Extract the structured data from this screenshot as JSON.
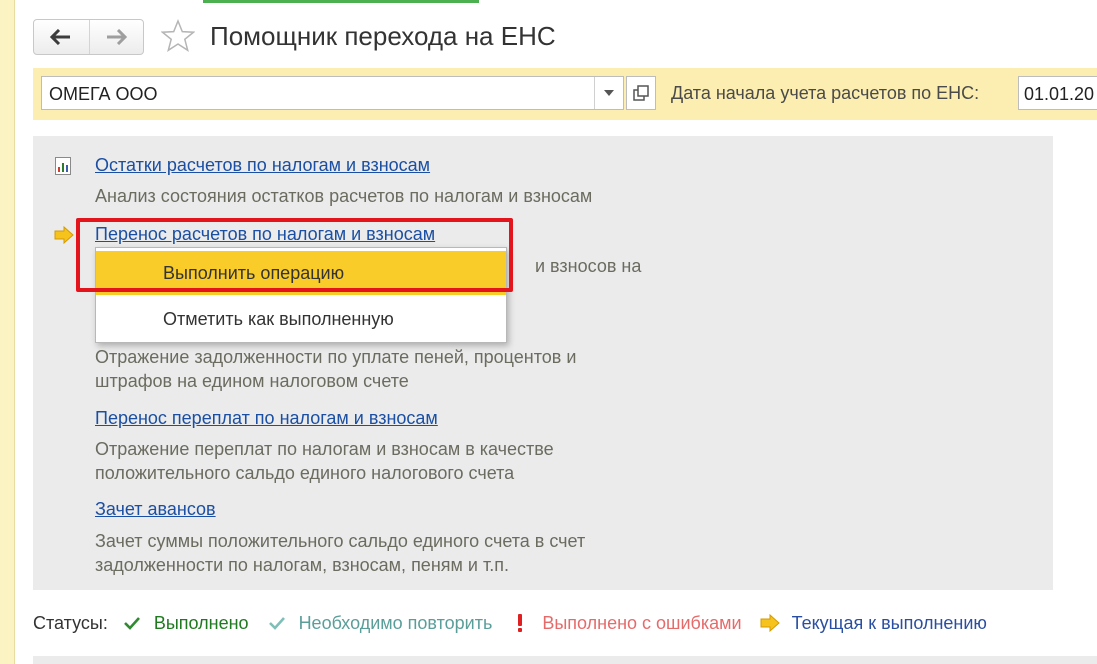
{
  "window": {
    "title": "Помощник перехода на ЕНС"
  },
  "navigation": {
    "back_icon": "arrow-left-icon",
    "forward_icon": "arrow-right-icon",
    "favorite_icon": "star-icon"
  },
  "filters": {
    "organization_value": "ОМЕГА ООО",
    "date_label": "Дата начала учета расчетов по ЕНС:",
    "date_value": "01.01.20"
  },
  "tasks": [
    {
      "link": "Остатки расчетов по налогам и взносам",
      "description": "Анализ состояния остатков расчетов по налогам и взносам",
      "status_icon": "report-icon"
    },
    {
      "link": "Перенос расчетов по налогам и взносам",
      "description_fragment": "и взносов на",
      "status_icon": "current-arrow-icon"
    },
    {
      "description_line1": "Отражение задолженности по уплате пеней, процентов и",
      "description_line2": "штрафов на едином налоговом счете"
    },
    {
      "link": "Перенос переплат по налогам и взносам",
      "description_line1": "Отражение переплат по налогам и взносам в качестве",
      "description_line2": "положительного сальдо единого налогового счета"
    },
    {
      "link": "Зачет авансов",
      "description_line1": "Зачет суммы положительного сальдо единого счета в счет",
      "description_line2": "задолженности по налогам, взносам, пеням и т.п."
    }
  ],
  "context_menu": {
    "items": [
      "Выполнить операцию",
      "Отметить как выполненную"
    ],
    "active_index": 0
  },
  "legend": {
    "label": "Статусы:",
    "items": [
      {
        "icon": "check-icon",
        "text": "Выполнено",
        "color": "#1f7a1f"
      },
      {
        "icon": "check-light-icon",
        "text": "Необходимо повторить",
        "color": "#5a9e9a"
      },
      {
        "icon": "exclamation-icon",
        "text": "Выполнено с ошибками",
        "color": "#e56b6b"
      },
      {
        "icon": "arrow-right-icon",
        "text": "Текущая к выполнению",
        "color": "#2a4fa0"
      }
    ]
  },
  "colors": {
    "accent_yellow": "#f9cc2a",
    "link": "#1a4fa3",
    "highlight_frame": "#e3141b",
    "filter_bar": "#fbeeb0"
  }
}
